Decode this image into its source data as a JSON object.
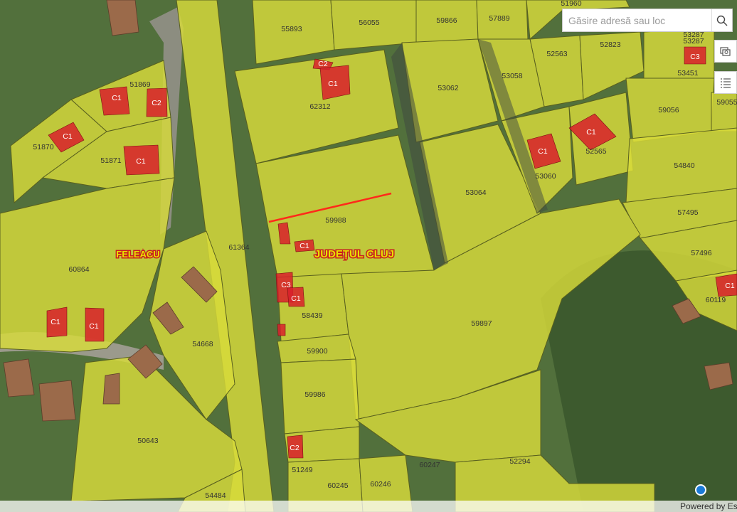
{
  "search": {
    "placeholder": "Găsire adresă sau loc"
  },
  "icons": {
    "search": "search-icon",
    "layers": "layers-icon",
    "legend": "legend-list-icon",
    "location": "current-location-icon"
  },
  "colors": {
    "parcel_fill": "#d8dc3a",
    "parcel_stroke": "#59601f",
    "building_fill": "#d8202c",
    "survey_line": "#ff2a1a",
    "place_label_fill": "#e8e000",
    "place_label_stroke": "#c81e1e"
  },
  "place_labels": {
    "locality": "FELEACU",
    "county": "JUDEȚUL CLUJ"
  },
  "parcel_labels": [
    "51960",
    "55893",
    "56055",
    "59866",
    "57889",
    "52563",
    "52823",
    "53287",
    "53287",
    "53451",
    "53058",
    "53062",
    "62312",
    "59056",
    "59055",
    "51869",
    "51870",
    "51871",
    "52565",
    "53060",
    "54840",
    "53064",
    "59988",
    "57495",
    "61364",
    "60864",
    "57496",
    "60119",
    "58439",
    "59897",
    "54668",
    "59900",
    "59986",
    "50643",
    "60247",
    "52294",
    "51249",
    "60245",
    "60246",
    "54484"
  ],
  "building_labels": [
    "C2",
    "C1",
    "C3",
    "C1",
    "C2",
    "C1",
    "C1",
    "C1",
    "C1",
    "C1",
    "C1",
    "C3",
    "C1",
    "C1",
    "C1",
    "C2",
    "C1",
    "C1"
  ],
  "attribution": {
    "text": "Powered by Es"
  }
}
